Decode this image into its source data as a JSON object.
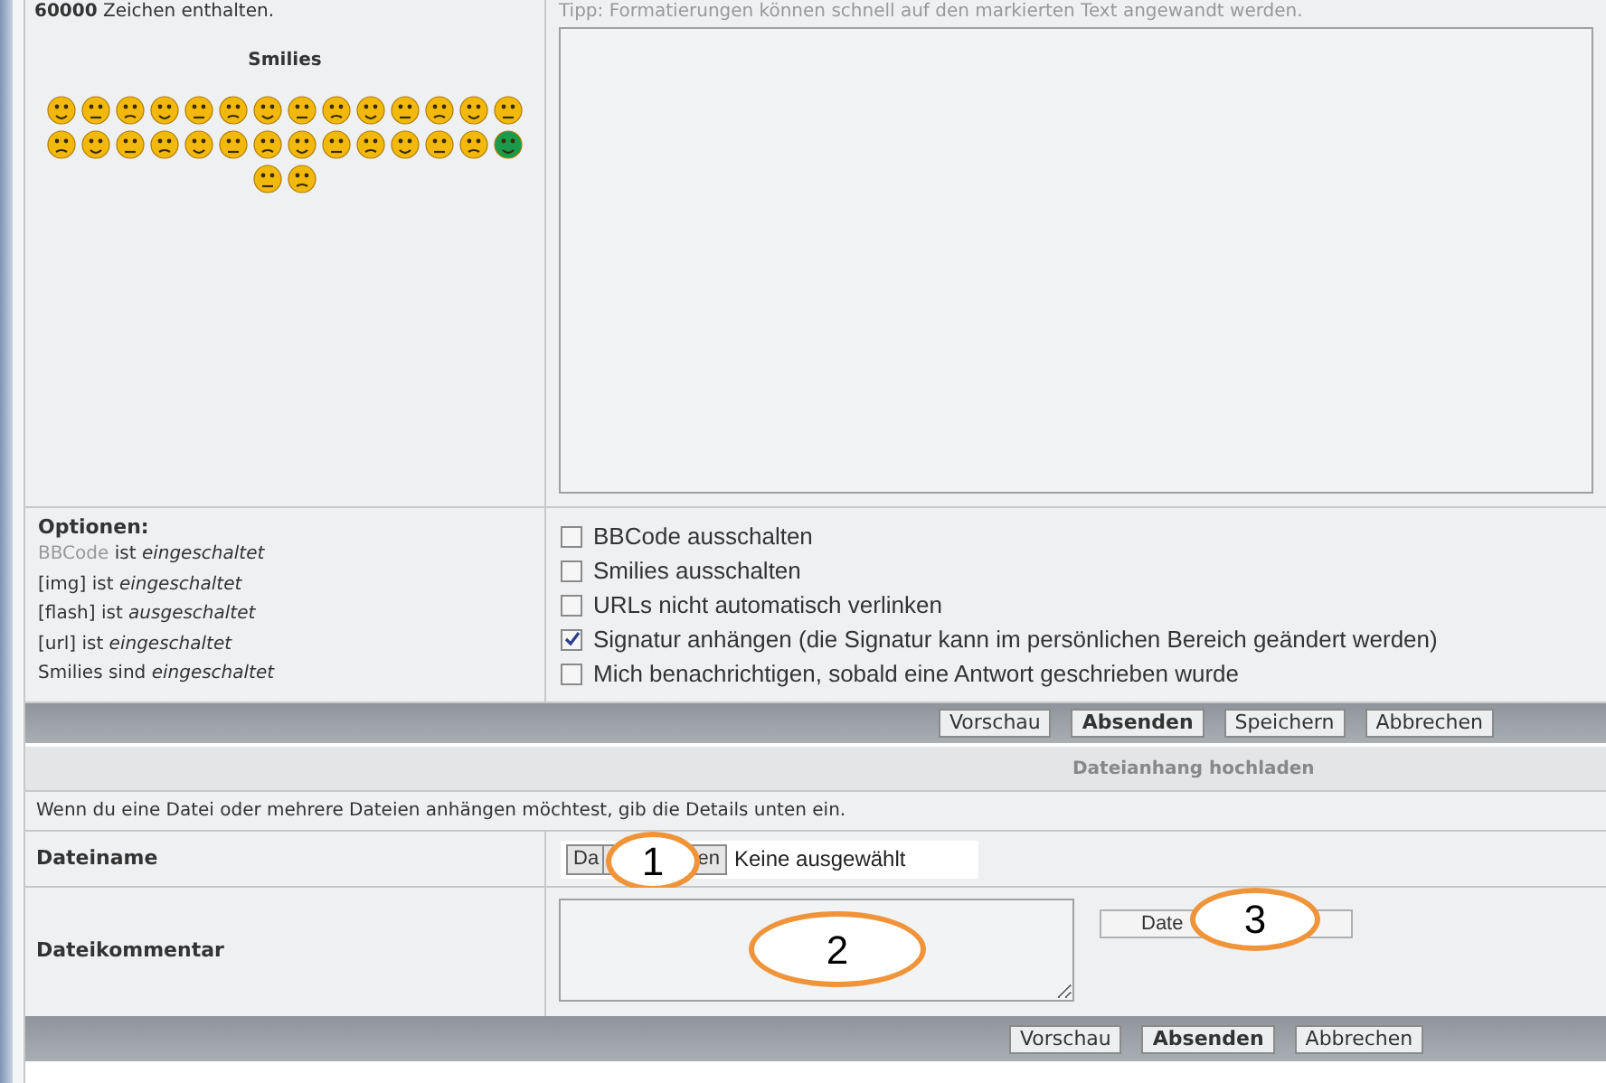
{
  "editor": {
    "char_limit_number": "60000",
    "char_limit_text": "Zeichen enthalten.",
    "smilies_heading": "Smilies",
    "tip": "Tipp: Formatierungen können schnell auf den markierten Text angewandt werden."
  },
  "options": {
    "heading": "Optionen:",
    "status": [
      {
        "link": "BBCode",
        "text": "ist *eingeschaltet*"
      },
      {
        "text": "[img] ist *eingeschaltet*"
      },
      {
        "text": "[flash] ist *ausgeschaltet*"
      },
      {
        "text": "[url] ist *eingeschaltet*"
      },
      {
        "text": "Smilies sind *eingeschaltet*"
      }
    ],
    "checkboxes": [
      {
        "label": "BBCode ausschalten",
        "checked": false
      },
      {
        "label": "Smilies ausschalten",
        "checked": false
      },
      {
        "label": "URLs nicht automatisch verlinken",
        "checked": false
      },
      {
        "label": "Signatur anhängen (die Signatur kann im persönlichen Bereich geändert werden)",
        "checked": true
      },
      {
        "label": "Mich benachrichtigen, sobald eine Antwort geschrieben wurde",
        "checked": false
      }
    ]
  },
  "buttons": [
    {
      "label": "Vorschau",
      "primary": false
    },
    {
      "label": "Absenden",
      "primary": true
    },
    {
      "label": "Speichern",
      "primary": false
    },
    {
      "label": "Abbrechen",
      "primary": false
    }
  ],
  "attachment": {
    "title": "Dateianhang hochladen",
    "info": "Wenn du eine Datei oder mehrere Dateien anhängen möchtest, gib die Details unten ein.",
    "filename_label": "Dateiname",
    "file_button_parts": [
      "Da",
      "en"
    ],
    "file_status": "Keine ausgewählt",
    "comment_label": "Dateikommentar",
    "add_button": "Date"
  },
  "bottom_buttons": [
    {
      "label": "Vorschau",
      "primary": false
    },
    {
      "label": "Absenden",
      "primary": true
    },
    {
      "label": "Abbrechen",
      "primary": false
    }
  ],
  "callouts": [
    "1",
    "2",
    "3"
  ]
}
